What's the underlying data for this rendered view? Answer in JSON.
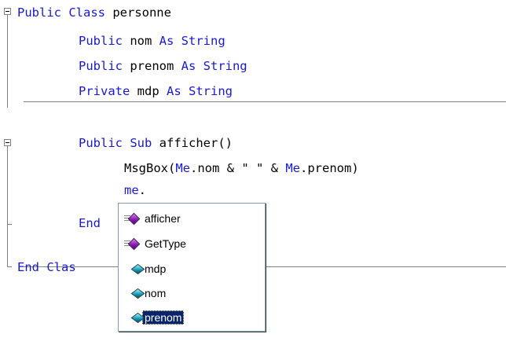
{
  "code": {
    "lines": [
      {
        "pre": "",
        "kw1": "Public Class",
        "mid": " personne",
        "kw2": "",
        "post": ""
      },
      {
        "pre": "    ",
        "kw1": "Public",
        "mid": " nom ",
        "kw2": "As String",
        "post": ""
      },
      {
        "pre": "    ",
        "kw1": "Public",
        "mid": " prenom ",
        "kw2": "As String",
        "post": ""
      },
      {
        "pre": "    ",
        "kw1": "Private",
        "mid": " mdp ",
        "kw2": "As String",
        "post": ""
      },
      {
        "pre": "    ",
        "kw1": "Public Sub",
        "mid": " afficher()",
        "kw2": "",
        "post": ""
      },
      {
        "pre": "        ",
        "msgbox": "MsgBox(",
        "me1": "Me",
        "nom": ".nom & \" \" & ",
        "me2": "Me",
        "prenom": ".prenom)"
      },
      {
        "pre": "        ",
        "kw1": "me",
        "mid": ".",
        "kw2": "",
        "post": ""
      },
      {
        "pre": "    ",
        "kw1": "End",
        "mid": "",
        "kw2": "",
        "post": ""
      },
      {
        "pre": "",
        "kw1": "End Clas",
        "mid": "",
        "kw2": "",
        "post": ""
      }
    ]
  },
  "completion": {
    "items": [
      {
        "label": "afficher",
        "icon": "method-icon"
      },
      {
        "label": "GetType",
        "icon": "method-icon"
      },
      {
        "label": "mdp",
        "icon": "field-icon"
      },
      {
        "label": "nom",
        "icon": "field-icon"
      },
      {
        "label": "prenom",
        "icon": "field-icon"
      }
    ],
    "selected": "prenom"
  },
  "colors": {
    "keyword": "#1818d8",
    "selection": "#0a246a",
    "outline": "#808080"
  }
}
